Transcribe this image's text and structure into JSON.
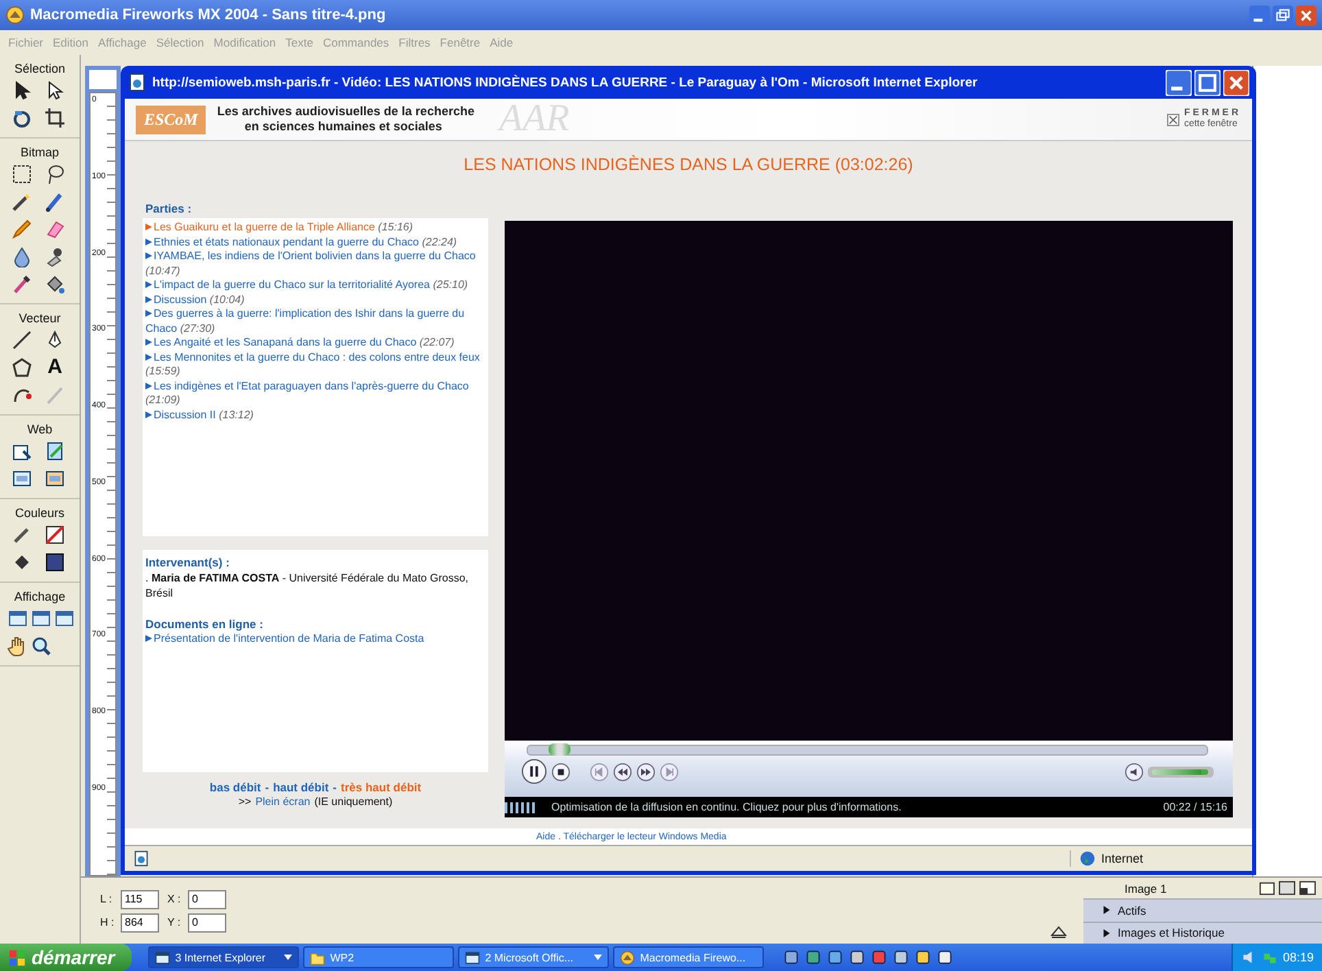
{
  "fireworks": {
    "title": "Macromedia Fireworks MX 2004 - Sans titre-4.png",
    "menu": [
      "Fichier",
      "Edition",
      "Affichage",
      "Sélection",
      "Modification",
      "Texte",
      "Commandes",
      "Filtres",
      "Fenêtre",
      "Aide"
    ],
    "tool_sections": [
      {
        "label": "Sélection",
        "kind": "selection"
      },
      {
        "label": "Bitmap",
        "kind": "bitmap"
      },
      {
        "label": "Vecteur",
        "kind": "vector"
      },
      {
        "label": "Web",
        "kind": "web"
      },
      {
        "label": "Couleurs",
        "kind": "colors"
      },
      {
        "label": "Affichage",
        "kind": "view"
      }
    ],
    "text_tool_glyph": "A",
    "ruler_marks": [
      "0",
      "100",
      "200",
      "300",
      "400",
      "500",
      "600",
      "700",
      "800",
      "900"
    ],
    "size_fields": [
      {
        "label": "L :",
        "value": "115"
      },
      {
        "label": "H :",
        "value": "864"
      }
    ],
    "position_fields": [
      {
        "label": "X :",
        "value": "0"
      },
      {
        "label": "Y :",
        "value": "0"
      }
    ],
    "frame_label": "Image 1",
    "panels": [
      {
        "label": "Actifs",
        "expanded": false
      },
      {
        "label": "Images et Historique",
        "expanded": false
      }
    ]
  },
  "browser": {
    "title": "http://semioweb.msh-paris.fr - Vidéo: LES NATIONS INDIGÈNES DANS LA GUERRE - Le Paraguay à l'Om - Microsoft Internet Explorer",
    "logo": "ESCoM",
    "logo_mark": "AAR",
    "banner_lines": [
      "Les archives audiovisuelles de la recherche",
      "en sciences humaines et sociales"
    ],
    "close_link": {
      "line1": "FERMER",
      "line2": "cette fenêtre"
    },
    "heading": "LES NATIONS INDIGÈNES DANS LA GUERRE (03:02:26)",
    "parts_heading": "Parties :",
    "parts": [
      {
        "title": "Les Guaikuru et la guerre de la Triple Alliance",
        "duration": "(15:16)",
        "selected": true
      },
      {
        "title": "Ethnies et états nationaux pendant la guerre du Chaco",
        "duration": "(22:24)",
        "selected": false
      },
      {
        "title": "IYAMBAE, les indiens de l'Orient bolivien dans la guerre du Chaco",
        "duration": "(10:47)",
        "selected": false
      },
      {
        "title": "L'impact de la guerre du Chaco sur la territorialité Ayorea",
        "duration": "(25:10)",
        "selected": false
      },
      {
        "title": "Discussion",
        "duration": "(10:04)",
        "selected": false
      },
      {
        "title": "Des guerres à la guerre: l'implication des Ishir dans la guerre du Chaco",
        "duration": "(27:30)",
        "selected": false
      },
      {
        "title": "Les Angaité et les Sanapaná dans la guerre du Chaco",
        "duration": "(22:07)",
        "selected": false
      },
      {
        "title": "Les Mennonites et la guerre du Chaco : des colons entre deux feux",
        "duration": "(15:59)",
        "selected": false
      },
      {
        "title": "Les indigènes et l'Etat paraguayen dans l'après-guerre du Chaco",
        "duration": "(21:09)",
        "selected": false
      },
      {
        "title": "Discussion II",
        "duration": "(13:12)",
        "selected": false
      }
    ],
    "speakers_heading": "Intervenant(s) :",
    "speaker": ". **Maria de FATIMA COSTA** - Université Fédérale du Mato Grosso, Brésil",
    "documents_heading": "Documents en ligne :",
    "documents": [
      "Présentation de l'intervention de Maria de Fatima Costa"
    ],
    "bitrates": [
      {
        "label": "bas débit",
        "selected": false
      },
      {
        "label": "haut débit",
        "selected": false
      },
      {
        "label": "très haut débit",
        "selected": true
      }
    ],
    "bitrate_separators": [
      "-",
      "-"
    ],
    "fullscreen": {
      "prefix": ">>",
      "link": "Plein écran",
      "suffix": "(IE uniquement)"
    },
    "player": {
      "seek": {
        "level": 0.03
      },
      "volume": {
        "level": 0.98
      },
      "status": "Optimisation de la diffusion en continu. Cliquez pour plus d'informations.",
      "time": "00:22 / 15:16"
    },
    "footer_link": "Aide . Télécharger le lecteur Windows Media",
    "zone": "Internet"
  },
  "taskbar": {
    "start": "démarrer",
    "tasks": [
      {
        "label": "3 Internet Explorer",
        "selected": true,
        "kind": "group"
      },
      {
        "label": "WP2",
        "selected": false,
        "kind": "folder"
      },
      {
        "label": "2 Microsoft Offic...",
        "selected": false,
        "kind": "group"
      },
      {
        "label": "Macromedia Firewo...",
        "selected": false,
        "kind": "app"
      }
    ],
    "clock": "08:19"
  }
}
